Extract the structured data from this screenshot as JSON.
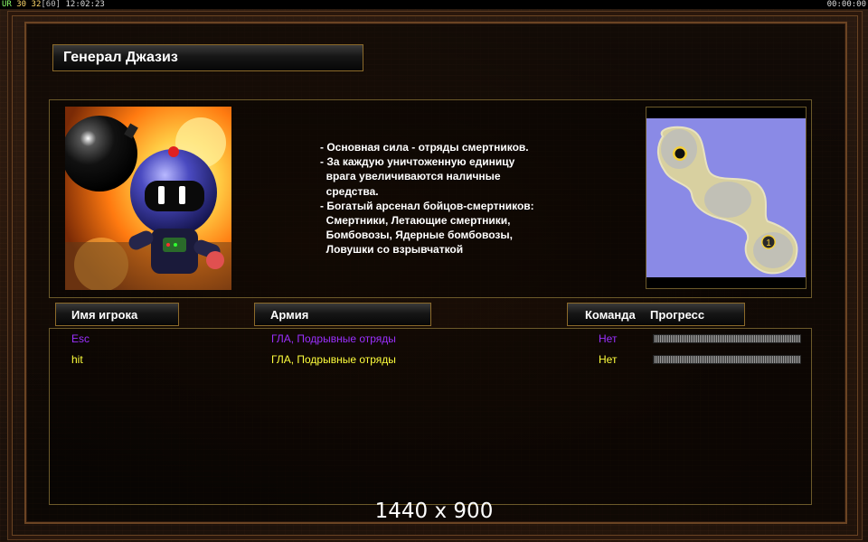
{
  "topbar": {
    "left_prefix": "UR",
    "fps_a": "30",
    "fps_b": "32",
    "fps_c": "[60]",
    "clock": "12:02:23",
    "timer": "00:00:00"
  },
  "general": {
    "name": "Генерал Джазиз",
    "description": [
      "- Основная сила - отряды смертников.",
      "- За каждую уничтоженную единицу",
      "  врага увеличиваются наличные",
      "  средства.",
      "- Богатый арсенал бойцов-смертников:",
      "  Смертники, Летающие смертники,",
      "  Бомбовозы, Ядерные бомбовозы,",
      "  Ловушки со взрывчаткой"
    ]
  },
  "minimap": {
    "start_marker_1": "1"
  },
  "columns": {
    "player_name": "Имя игрока",
    "army": "Армия",
    "team": "Команда",
    "progress": "Прогресс"
  },
  "players": [
    {
      "name": "Esc",
      "army": "ГЛА, Подрывные отряды",
      "team": "Нет",
      "color": "#9b30ff",
      "progress": 0
    },
    {
      "name": "hit",
      "army": "ГЛА, Подрывные отряды",
      "team": "Нет",
      "color": "#ffff3c",
      "progress": 0
    }
  ],
  "overlay": {
    "resolution": "1440 x 900"
  }
}
